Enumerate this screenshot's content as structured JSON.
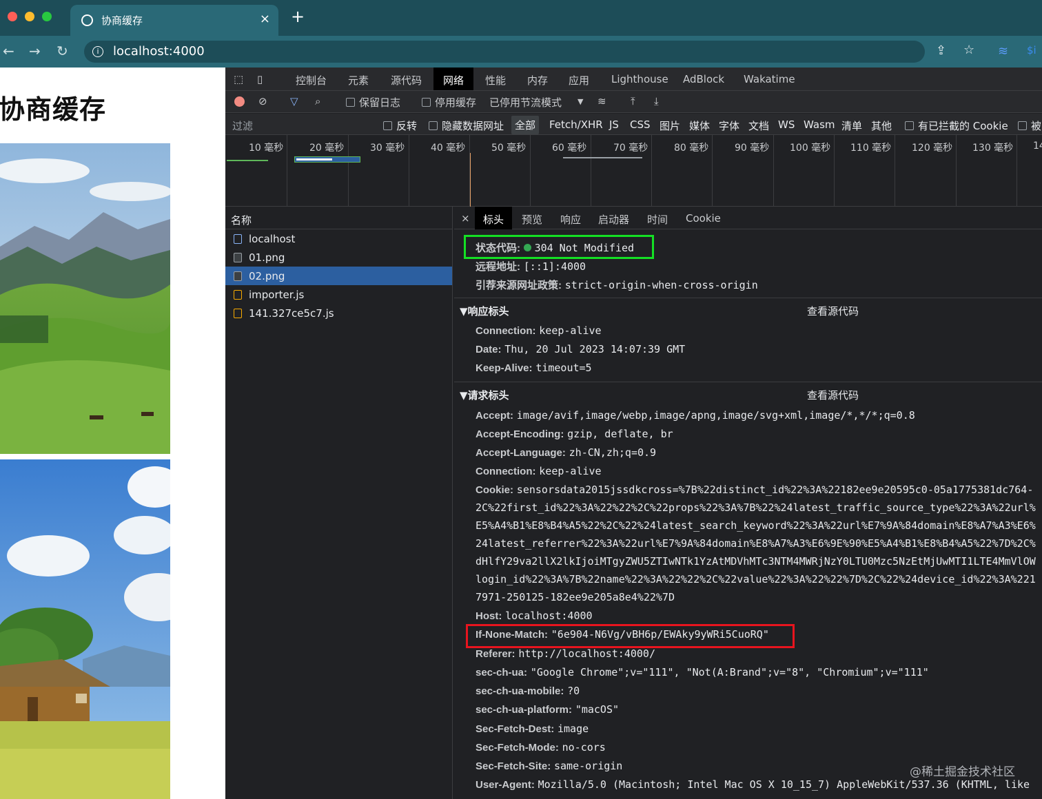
{
  "browser": {
    "tab_title": "协商缓存",
    "tab_close": "×",
    "new_tab": "+",
    "back": "←",
    "forward": "→",
    "reload": "↻",
    "url": "localhost:4000",
    "info_icon": "i",
    "share_icon": "⇪",
    "star_icon": "☆",
    "ext_icon": "≋",
    "ext2": "$i"
  },
  "page": {
    "title": "协商缓存"
  },
  "devtools": {
    "tabs": [
      "控制台",
      "元素",
      "源代码",
      "网络",
      "性能",
      "内存",
      "应用",
      "Lighthouse",
      "AdBlock",
      "Wakatime"
    ],
    "active_tab": "网络",
    "toolbar": {
      "preserve_log": "保留日志",
      "disable_cache": "停用缓存",
      "throttle": "已停用节流模式",
      "arrow": "▼"
    },
    "filter": {
      "placeholder": "过滤",
      "invert": "反转",
      "hide_data_urls": "隐藏数据网址",
      "all": "全部",
      "types": [
        "Fetch/XHR",
        "JS",
        "CSS",
        "图片",
        "媒体",
        "字体",
        "文档",
        "WS",
        "Wasm",
        "清单",
        "其他"
      ],
      "blocked_cookies": "有已拦截的 Cookie",
      "blocked": "被"
    },
    "timeline_ticks": [
      "10 毫秒",
      "20 毫秒",
      "30 毫秒",
      "40 毫秒",
      "50 毫秒",
      "60 毫秒",
      "70 毫秒",
      "80 毫秒",
      "90 毫秒",
      "100 毫秒",
      "110 毫秒",
      "120 毫秒",
      "130 毫秒",
      "14"
    ],
    "name_header": "名称",
    "requests": [
      {
        "name": "localhost",
        "type": "doc"
      },
      {
        "name": "01.png",
        "type": "img"
      },
      {
        "name": "02.png",
        "type": "img",
        "selected": true
      },
      {
        "name": "importer.js",
        "type": "js"
      },
      {
        "name": "141.327ce5c7.js",
        "type": "js"
      }
    ],
    "detail_tabs": [
      "标头",
      "预览",
      "响应",
      "启动器",
      "时间",
      "Cookie"
    ],
    "close": "×",
    "general": {
      "status_key": "状态代码:",
      "status_val": "304 Not Modified",
      "remote_key": "远程地址:",
      "remote_val": "[::1]:4000",
      "referrer_key": "引荐来源网址政策:",
      "referrer_val": "strict-origin-when-cross-origin"
    },
    "response_headers": {
      "title": "▼响应标头",
      "view_source": "查看源代码",
      "items": [
        {
          "k": "Connection:",
          "v": "keep-alive"
        },
        {
          "k": "Date:",
          "v": "Thu, 20 Jul 2023 14:07:39 GMT"
        },
        {
          "k": "Keep-Alive:",
          "v": "timeout=5"
        }
      ]
    },
    "request_headers": {
      "title": "▼请求标头",
      "view_source": "查看源代码",
      "accept_k": "Accept:",
      "accept_v": "image/avif,image/webp,image/apng,image/svg+xml,image/*,*/*;q=0.8",
      "enc_k": "Accept-Encoding:",
      "enc_v": "gzip, deflate, br",
      "lang_k": "Accept-Language:",
      "lang_v": "zh-CN,zh;q=0.9",
      "conn_k": "Connection:",
      "conn_v": "keep-alive",
      "cookie_k": "Cookie:",
      "cookie_lines": [
        "sensorsdata2015jssdkcross=%7B%22distinct_id%22%3A%22182ee9e20595c0-05a1775381dc764-",
        "2C%22first_id%22%3A%22%22%2C%22props%22%3A%7B%22%24latest_traffic_source_type%22%3A%22url%",
        "E5%A4%B1%E8%B4%A5%22%2C%22%24latest_search_keyword%22%3A%22url%E7%9A%84domain%E8%A7%A3%E6%",
        "24latest_referrer%22%3A%22url%E7%9A%84domain%E8%A7%A3%E6%9E%90%E5%A4%B1%E8%B4%A5%22%7D%2C%",
        "dHlfY29va2llX2lkIjoiMTgyZWU5ZTIwNTk1YzAtMDVhMTc3NTM4MWRjNzY0LTU0Mzc5NzEtMjUwMTI1LTE4MmVlOW",
        "login_id%22%3A%7B%22name%22%3A%22%22%2C%22value%22%3A%22%22%7D%2C%22%24device_id%22%3A%221",
        "7971-250125-182ee9e205a8e4%22%7D"
      ],
      "host_k": "Host:",
      "host_v": "localhost:4000",
      "inm_k": "If-None-Match:",
      "inm_v": "\"6e904-N6Vg/vBH6p/EWAky9yWRi5CuoRQ\"",
      "ref_k": "Referer:",
      "ref_v": "http://localhost:4000/",
      "ua_k": "sec-ch-ua:",
      "ua_v": "\"Google Chrome\";v=\"111\", \"Not(A:Brand\";v=\"8\", \"Chromium\";v=\"111\"",
      "mob_k": "sec-ch-ua-mobile:",
      "mob_v": "?0",
      "plat_k": "sec-ch-ua-platform:",
      "plat_v": "\"macOS\"",
      "dest_k": "Sec-Fetch-Dest:",
      "dest_v": "image",
      "mode_k": "Sec-Fetch-Mode:",
      "mode_v": "no-cors",
      "site_k": "Sec-Fetch-Site:",
      "site_v": "same-origin",
      "agent_k": "User-Agent:",
      "agent_v": "Mozilla/5.0 (Macintosh; Intel Mac OS X 10_15_7) AppleWebKit/537.36 (KHTML, like"
    }
  },
  "watermark": "@稀土掘金技术社区",
  "colors": {
    "highlight_green": "#14e024",
    "highlight_red": "#e8141e",
    "status_dot": "#34a853"
  }
}
